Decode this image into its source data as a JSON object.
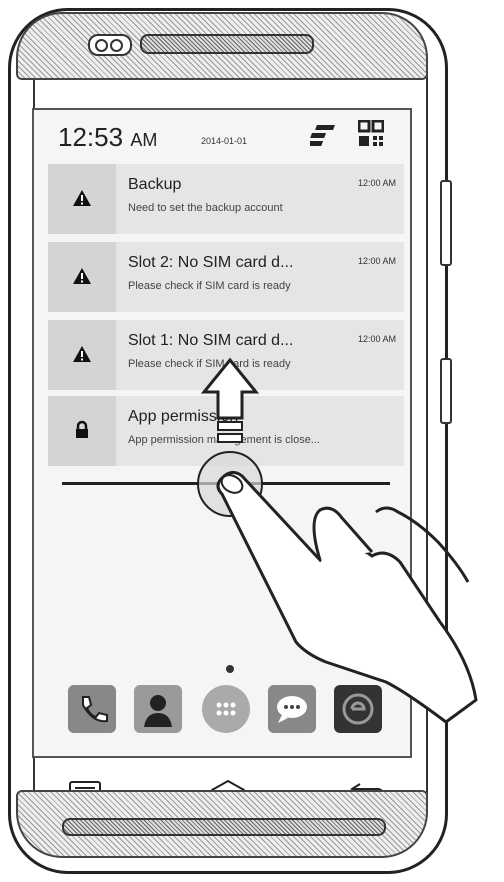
{
  "status": {
    "time": "12:53",
    "ampm": "AM",
    "date": "2014-01-01"
  },
  "header_icons": [
    "toggle-icon",
    "qr-grid-icon"
  ],
  "notifications": [
    {
      "icon": "warning-icon",
      "title": "Backup",
      "message": "Need to set the backup account",
      "time": "12:00 AM"
    },
    {
      "icon": "warning-icon",
      "title": "Slot 2: No SIM card d...",
      "message": "Please check if SIM card is ready",
      "time": "12:00 AM"
    },
    {
      "icon": "warning-icon",
      "title": "Slot 1: No SIM card d...",
      "message": "Please check if SIM card is ready",
      "time": "12:00 AM"
    },
    {
      "icon": "lock-icon",
      "title": "App permission",
      "message": "App permission management is close...",
      "time": ""
    }
  ],
  "dock": [
    {
      "name": "phone-icon"
    },
    {
      "name": "contacts-icon"
    },
    {
      "name": "apps-icon"
    },
    {
      "name": "messages-icon"
    },
    {
      "name": "browser-icon"
    }
  ],
  "nav_keys": [
    "menu-key-icon",
    "home-key-icon",
    "back-key-icon"
  ],
  "colors": {
    "notification_bg": "#e5e5e5",
    "icon_box_bg": "#d4d4d4",
    "dock_icon": "#888888",
    "outline": "#222222"
  }
}
